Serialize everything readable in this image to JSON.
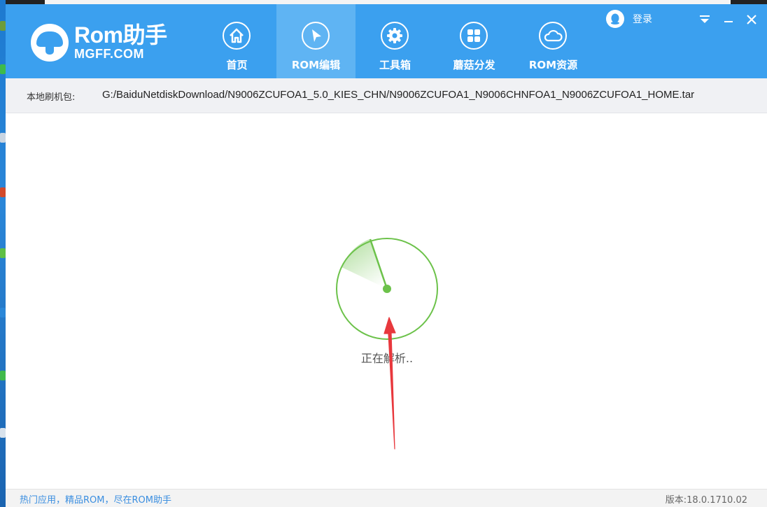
{
  "app": {
    "logo_title": "Rom助手",
    "logo_subtitle": "MGFF.COM"
  },
  "nav": {
    "items": [
      {
        "label": "首页",
        "icon": "home-icon",
        "active": false
      },
      {
        "label": "ROM编辑",
        "icon": "cursor-icon",
        "active": true
      },
      {
        "label": "工具箱",
        "icon": "gear-icon",
        "active": false
      },
      {
        "label": "蘑菇分发",
        "icon": "grid-icon",
        "active": false
      },
      {
        "label": "ROM资源",
        "icon": "cloud-icon",
        "active": false
      }
    ]
  },
  "header": {
    "login_label": "登录"
  },
  "pathbar": {
    "label": "本地刷机包:",
    "value": "G:/BaiduNetdiskDownload/N9006ZCUFOA1_5.0_KIES_CHN/N9006ZCUFOA1_N9006CHNFOA1_N9006ZCUFOA1_HOME.tar"
  },
  "main": {
    "status": "正在解析.."
  },
  "footer": {
    "link_text": "热门应用，精品ROM，尽在ROM助手",
    "version": "版本:18.0.1710.02"
  },
  "colors": {
    "header_bg": "#3ba0ef",
    "nav_active_bg": "#5fb4f3",
    "spinner_green": "#6cc24a",
    "annotation_arrow": "#e8383d"
  }
}
